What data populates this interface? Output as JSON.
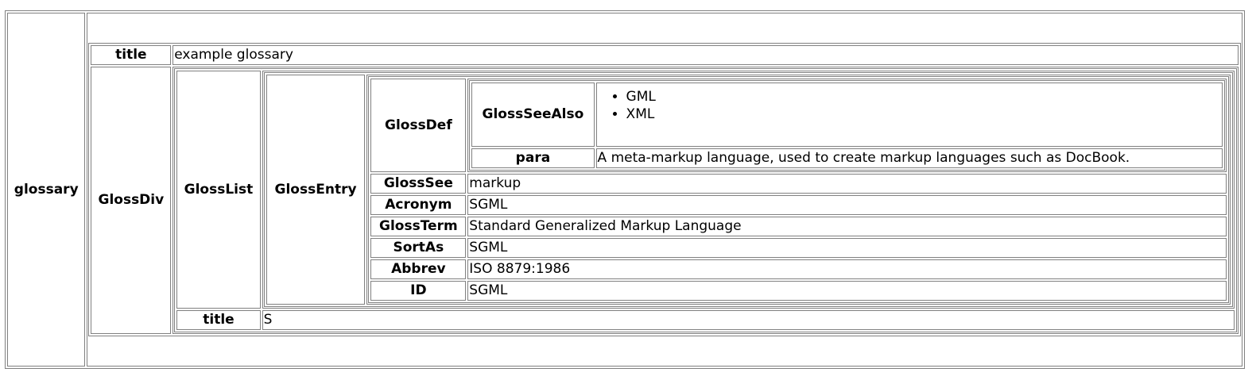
{
  "glossary": {
    "key": "glossary",
    "title_key": "title",
    "title_value": "example glossary",
    "glossdiv_key": "GlossDiv",
    "glosslist_key": "GlossList",
    "glossentry_key": "GlossEntry",
    "glossdef_key": "GlossDef",
    "glossseealso_key": "GlossSeeAlso",
    "glossseealso_items": [
      "GML",
      "XML"
    ],
    "para_key": "para",
    "para_value": "A meta-markup language, used to create markup languages such as DocBook.",
    "glosssee_key": "GlossSee",
    "glosssee_value": "markup",
    "acronym_key": "Acronym",
    "acronym_value": "SGML",
    "glossterm_key": "GlossTerm",
    "glossterm_value": "Standard Generalized Markup Language",
    "sortas_key": "SortAs",
    "sortas_value": "SGML",
    "abbrev_key": "Abbrev",
    "abbrev_value": "ISO 8879:1986",
    "id_key": "ID",
    "id_value": "SGML",
    "glossdiv_title_key": "title",
    "glossdiv_title_value": "S"
  }
}
